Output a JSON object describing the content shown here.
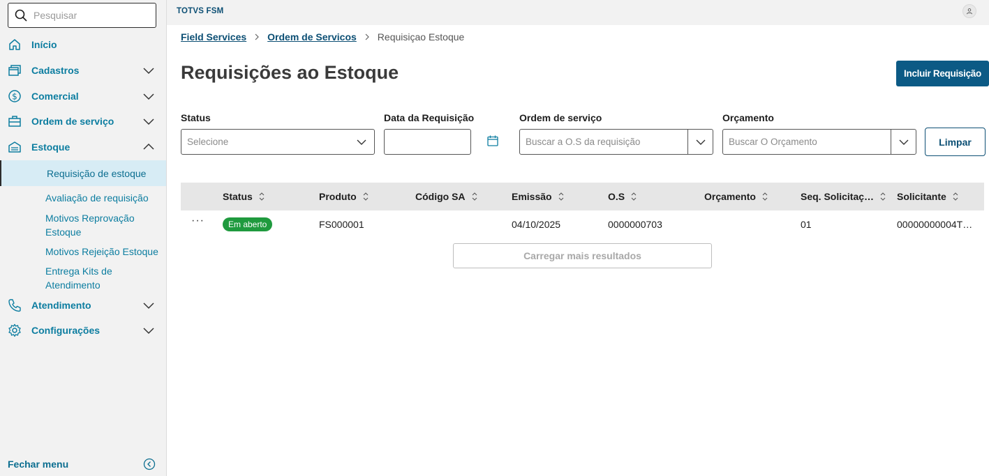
{
  "search": {
    "placeholder": "Pesquisar"
  },
  "sidebar": {
    "items": [
      {
        "label": "Início",
        "icon": "home-icon"
      },
      {
        "label": "Cadastros",
        "icon": "cards-icon"
      },
      {
        "label": "Comercial",
        "icon": "dollar-circle-icon"
      },
      {
        "label": "Ordem de serviço",
        "icon": "briefcase-icon"
      },
      {
        "label": "Estoque",
        "icon": "warehouse-icon",
        "expanded": true
      },
      {
        "label": "Atendimento",
        "icon": "phone-icon"
      },
      {
        "label": "Configurações",
        "icon": "gear-icon"
      }
    ],
    "subitems": [
      {
        "label": "Requisição de estoque",
        "active": true
      },
      {
        "label": "Avaliação de requisição"
      },
      {
        "label": "Motivos Reprovação Estoque"
      },
      {
        "label": "Motivos Rejeição Estoque"
      },
      {
        "label": "Entrega Kits de Atendimento"
      }
    ],
    "footer_label": "Fechar menu"
  },
  "topbar": {
    "app_name": "TOTVS FSM"
  },
  "breadcrumb": {
    "items": [
      "Field Services",
      "Ordem de Servicos"
    ],
    "current": "Requisiçao Estoque"
  },
  "page": {
    "title": "Requisições ao Estoque",
    "primary_button": "Incluir Requisição"
  },
  "filters": {
    "status": {
      "label": "Status",
      "placeholder": "Selecione"
    },
    "date": {
      "label": "Data da Requisição",
      "value": ""
    },
    "order": {
      "label": "Ordem de serviço",
      "placeholder": "Buscar a O.S da requisição"
    },
    "budget": {
      "label": "Orçamento",
      "placeholder": "Buscar O Orçamento"
    },
    "clear_button": "Limpar"
  },
  "table": {
    "columns": [
      "Status",
      "Produto",
      "Código SA",
      "Emissão",
      "O.S",
      "Orçamento",
      "Seq. Solicitaç…",
      "Solicitante"
    ],
    "rows": [
      {
        "status": "Em aberto",
        "produto": "FS000001",
        "codigo_sa": "",
        "emissao": "04/10/2025",
        "os": "0000000703",
        "orcamento": "",
        "seq": "01",
        "solicitante": "00000000004T…"
      }
    ],
    "row_actions": "···",
    "load_more": "Carregar mais resultados"
  },
  "colors": {
    "accent": "#0c7da0",
    "primary": "#0c5a85",
    "status_open": "#1f9a3e",
    "sidebar_bg": "#f2f2f2",
    "active_bg": "#d7ecf5"
  }
}
